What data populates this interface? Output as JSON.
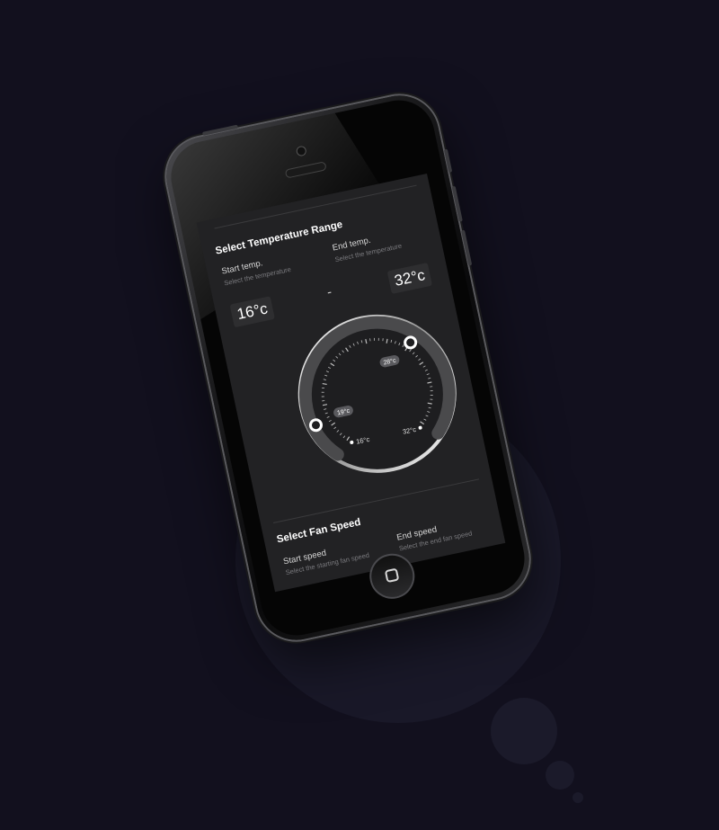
{
  "temperature": {
    "section_title": "Select Temperature Range",
    "start_label": "Start temp.",
    "start_sub": "Select the temperature",
    "end_label": "End temp.",
    "end_sub": "Select the temperature",
    "start_value": "16°c",
    "end_value": "32°c",
    "separator": "-",
    "dial": {
      "min_label": "16°c",
      "max_label": "32°c",
      "low_handle_label": "19°c",
      "high_handle_label": "28°c"
    }
  },
  "fan_speed": {
    "section_title": "Select Fan Speed",
    "start_label": "Start speed",
    "start_sub": "Select the starting fan speed",
    "end_label": "End speed",
    "end_sub": "Select the end fan speed"
  },
  "icons": {
    "home_button": "home-button-icon"
  },
  "colors": {
    "background": "#12101e",
    "screen": "#222224",
    "accent": "#ffffff"
  }
}
